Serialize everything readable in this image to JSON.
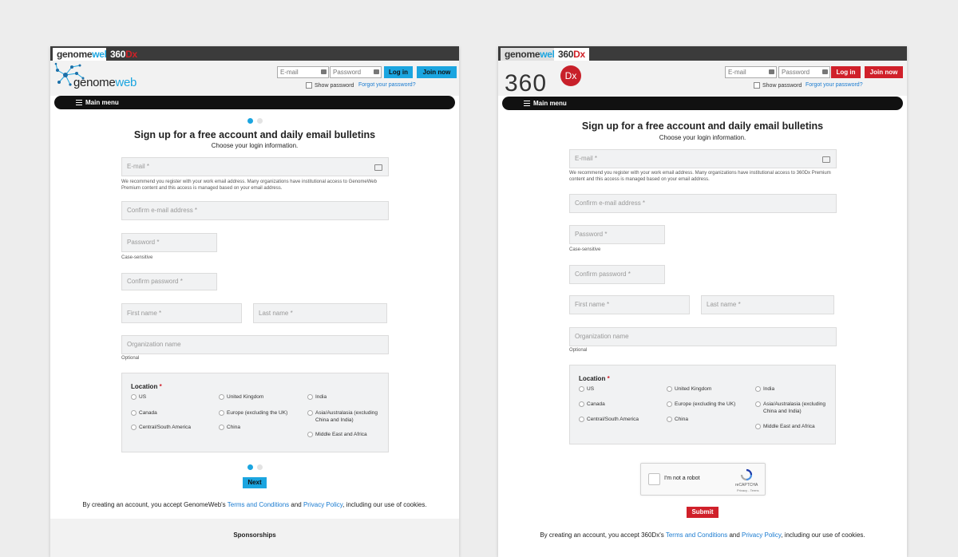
{
  "tabs": {
    "gw_a": "genome",
    "gw_b": "web",
    "dx_a": "360",
    "dx_b": "Dx"
  },
  "logos": {
    "gw_a": "genome",
    "gw_b": "web",
    "dx_num": "360",
    "dx_badge": "Dx"
  },
  "login": {
    "email_placeholder": "E-mail",
    "password_placeholder": "Password",
    "login_label": "Log in",
    "join_label": "Join now",
    "show_password": "Show password",
    "forgot": "Forgot your password?"
  },
  "menu": {
    "label": "Main menu"
  },
  "form": {
    "title": "Sign up for a free account and daily email bulletins",
    "subtitle": "Choose your login information.",
    "email": "E-mail *",
    "email_help_gw": "We recommend you register with your work email address. Many organizations have institutional access to GenomeWeb Premium content and this access is managed based on your email address.",
    "email_help_dx": "We recommend you register with your work email address. Many organizations have institutional access to 360Dx Premium content and this access is managed based on your email address.",
    "confirm_email": "Confirm e-mail address *",
    "password": "Password *",
    "case_sensitive": "Case-sensitive",
    "confirm_password": "Confirm password *",
    "first_name": "First name *",
    "last_name": "Last name *",
    "organization": "Organization name",
    "optional": "Optional",
    "location_title": "Location",
    "required_mark": "*",
    "locations": [
      "US",
      "United Kingdom",
      "India",
      "Canada",
      "Europe (excluding the UK)",
      "Asia/Australasia (excluding China and India)",
      "Central/South America",
      "China",
      "Middle East and Africa"
    ]
  },
  "actions": {
    "next": "Next",
    "submit": "Submit"
  },
  "captcha": {
    "label": "I'm not a robot",
    "brand": "reCAPTCHA",
    "links": "Privacy - Terms"
  },
  "footer": {
    "prefix_gw": "By creating an account, you accept GenomeWeb's",
    "prefix_dx": "By creating an account, you accept 360Dx's",
    "terms": "Terms and Conditions",
    "and": "and",
    "privacy": "Privacy Policy",
    "suffix": ", including our use of cookies.",
    "sponsorships": "Sponsorships"
  },
  "colors": {
    "gw_accent": "#1ba5e0",
    "dx_accent": "#d0202a",
    "link": "#1a7bd0"
  }
}
